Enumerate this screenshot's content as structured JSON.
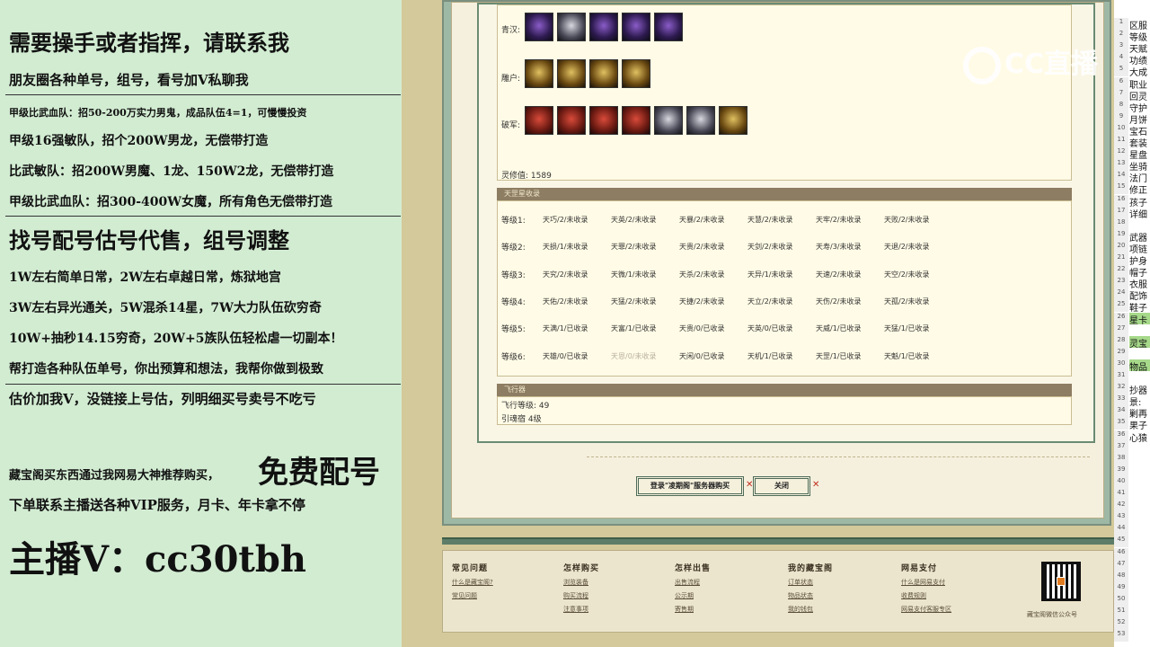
{
  "left_panel": {
    "lines": [
      {
        "text": "需要操手或者指挥，请联系我",
        "size": 24
      },
      {
        "text": "朋友圈各种单号，组号，看号加V私聊我",
        "size": 15
      },
      {
        "text": "甲级比武血队：招50-200万实力男鬼，成品队伍4=1，可慢慢投资",
        "size": 11
      },
      {
        "text": "甲级16强敏队，招个200W男龙，无偿带打造",
        "size": 14
      },
      {
        "text": "比武敏队：招200W男魔、1龙、150W2龙，无偿带打造",
        "size": 14
      },
      {
        "text": "甲级比武血队：招300-400W女魔，所有角色无偿带打造",
        "size": 14
      },
      {
        "text": "找号配号估号代售，组号调整",
        "size": 24
      },
      {
        "text": "1W左右简单日常，2W左右卓越日常，炼狱地宫",
        "size": 14
      },
      {
        "text": "3W左右异光通关，5W混杀14星，7W大力队伍砍穷奇",
        "size": 14
      },
      {
        "text": "10W+抽秒14.15穷奇，20W+5族队伍轻松虐一切副本！",
        "size": 14
      },
      {
        "text": "帮打造各种队伍单号，你出预算和想法，我帮你做到极致",
        "size": 14
      },
      {
        "text": "估价加我V，没链接上号估，列明细买号卖号不吃亏",
        "size": 15
      },
      {
        "text": "藏宝阁买东西通过我网易大神推荐购买，",
        "size": 13
      },
      {
        "text": "免费配号",
        "size": 34
      },
      {
        "text": "下单联系主播送各种VIP服务，月卡、年卡拿不停",
        "size": 15
      },
      {
        "text": "主播V：cc30tbh",
        "size": 40
      }
    ]
  },
  "logo": {
    "text": "CC直播"
  },
  "equipment": {
    "rows": [
      {
        "label": "青汉:",
        "count": 5
      },
      {
        "label": "雕户:",
        "count": 4
      },
      {
        "label": "破军:",
        "count": 7
      }
    ],
    "lingxiu_label": "灵修值: 1589"
  },
  "tiangang": {
    "title": "天罡星收录",
    "levels": [
      {
        "label": "等级1:",
        "items": [
          "天巧/2/未收录",
          "天英/2/未收录",
          "天暴/2/未收录",
          "天慧/2/未收录",
          "天牢/2/未收录",
          "天败/2/未收录"
        ]
      },
      {
        "label": "等级2:",
        "items": [
          "天损/1/未收录",
          "天罪/2/未收录",
          "天贵/2/未收录",
          "天剑/2/未收录",
          "天寿/3/未收录",
          "天退/2/未收录"
        ]
      },
      {
        "label": "等级3:",
        "items": [
          "天究/2/未收录",
          "天微/1/未收录",
          "天杀/2/未收录",
          "天异/1/未收录",
          "天速/2/未收录",
          "天空/2/未收录"
        ]
      },
      {
        "label": "等级4:",
        "items": [
          "天佑/2/未收录",
          "天猛/2/未收录",
          "天捷/2/未收录",
          "天立/2/未收录",
          "天伤/2/未收录",
          "天孤/2/未收录"
        ]
      },
      {
        "label": "等级5:",
        "items": [
          "天满/1/已收录",
          "天富/1/已收录",
          "天贵/0/已收录",
          "天英/0/已收录",
          "天威/1/已收录",
          "天猛/1/已收录"
        ]
      },
      {
        "label": "等级6:",
        "items": [
          "天雄/0/已收录",
          "天恩/0/未收录",
          "天闲/0/已收录",
          "天机/1/已收录",
          "天罡/1/已收录",
          "天魁/1/已收录"
        ]
      }
    ],
    "dim_item": {
      "level": 5,
      "index": 1
    }
  },
  "flying": {
    "title": "飞行器",
    "level_label": "飞行等级: 49",
    "yinhun_label": "引魂宿  4级"
  },
  "buttons": {
    "buy_label": "登录\"凌期阁\"服务器购买",
    "close_label": "关闭"
  },
  "footer": {
    "columns": [
      {
        "title": "常见问题",
        "links": [
          "什么是藏宝阁?",
          "常见问题"
        ]
      },
      {
        "title": "怎样购买",
        "links": [
          "浏览装备",
          "购买流程",
          "注意事项"
        ]
      },
      {
        "title": "怎样出售",
        "links": [
          "出售流程",
          "公示期",
          "寄售期"
        ]
      },
      {
        "title": "我的藏宝阁",
        "links": [
          "订单状态",
          "物品状态",
          "我的钱包"
        ]
      },
      {
        "title": "网易支付",
        "links": [
          "什么是网易支付",
          "收费规则",
          "网易支付客服专区"
        ]
      }
    ],
    "company": "藏宝阁微信公众号"
  },
  "sheet": {
    "rows": [
      {
        "n": "1",
        "t": "区服"
      },
      {
        "n": "2",
        "t": "等级"
      },
      {
        "n": "3",
        "t": "天赋"
      },
      {
        "n": "4",
        "t": "功绩"
      },
      {
        "n": "5",
        "t": "大成"
      },
      {
        "n": "6",
        "t": "职业"
      },
      {
        "n": "7",
        "t": "回灵"
      },
      {
        "n": "8",
        "t": "守护"
      },
      {
        "n": "9",
        "t": "月饼"
      },
      {
        "n": "10",
        "t": "宝石"
      },
      {
        "n": "11",
        "t": "套装"
      },
      {
        "n": "12",
        "t": "星盘"
      },
      {
        "n": "13",
        "t": "坐骑"
      },
      {
        "n": "14",
        "t": "法门"
      },
      {
        "n": "15",
        "t": "修正"
      },
      {
        "n": "16",
        "t": "孩子"
      },
      {
        "n": "17",
        "t": "详细"
      },
      {
        "n": "18",
        "t": ""
      },
      {
        "n": "19",
        "t": "武器"
      },
      {
        "n": "20",
        "t": "项链"
      },
      {
        "n": "21",
        "t": "护身"
      },
      {
        "n": "22",
        "t": "帽子"
      },
      {
        "n": "23",
        "t": "衣服"
      },
      {
        "n": "24",
        "t": "配饰"
      },
      {
        "n": "25",
        "t": "鞋子"
      },
      {
        "n": "26",
        "t": "星卡",
        "hl": true
      },
      {
        "n": "27",
        "t": ""
      },
      {
        "n": "28",
        "t": "灵宝",
        "hl": true
      },
      {
        "n": "29",
        "t": ""
      },
      {
        "n": "30",
        "t": "物品",
        "hl": true
      },
      {
        "n": "31",
        "t": ""
      },
      {
        "n": "32",
        "t": "抄器"
      },
      {
        "n": "33",
        "t": "景:"
      },
      {
        "n": "34",
        "t": "剿再"
      },
      {
        "n": "35",
        "t": "果子"
      },
      {
        "n": "36",
        "t": "心猿"
      },
      {
        "n": "37",
        "t": ""
      },
      {
        "n": "38",
        "t": ""
      },
      {
        "n": "39",
        "t": ""
      },
      {
        "n": "40",
        "t": ""
      },
      {
        "n": "41",
        "t": ""
      },
      {
        "n": "42",
        "t": ""
      },
      {
        "n": "43",
        "t": ""
      },
      {
        "n": "44",
        "t": ""
      },
      {
        "n": "45",
        "t": ""
      },
      {
        "n": "46",
        "t": ""
      },
      {
        "n": "47",
        "t": ""
      },
      {
        "n": "48",
        "t": ""
      },
      {
        "n": "49",
        "t": ""
      },
      {
        "n": "50",
        "t": ""
      },
      {
        "n": "51",
        "t": ""
      },
      {
        "n": "52",
        "t": ""
      },
      {
        "n": "53",
        "t": ""
      }
    ]
  }
}
